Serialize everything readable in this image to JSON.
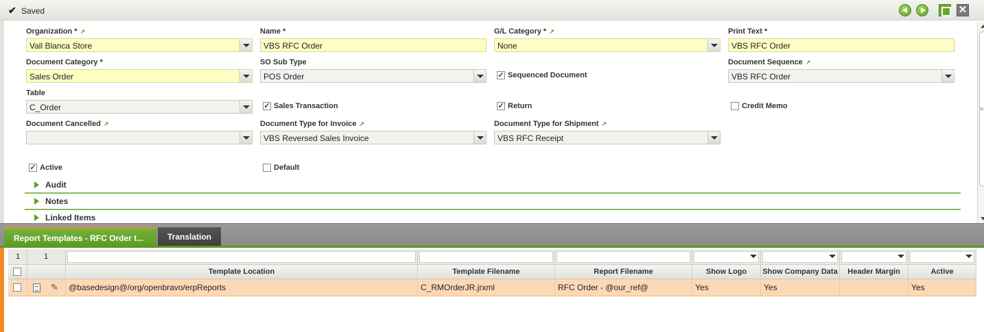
{
  "status": {
    "text": "Saved"
  },
  "form": {
    "fields": {
      "organization": {
        "label": "Organization *",
        "value": "Vall Blanca Store"
      },
      "name": {
        "label": "Name *",
        "value": "VBS RFC Order"
      },
      "gl_category": {
        "label": "G/L Category *",
        "value": "None"
      },
      "print_text": {
        "label": "Print Text *",
        "value": "VBS RFC Order"
      },
      "document_category": {
        "label": "Document Category *",
        "value": "Sales Order"
      },
      "so_sub_type": {
        "label": "SO Sub Type",
        "value": "POS Order"
      },
      "document_sequence": {
        "label": "Document Sequence",
        "value": "VBS RFC Order"
      },
      "table": {
        "label": "Table",
        "value": "C_Order"
      },
      "document_cancelled": {
        "label": "Document Cancelled",
        "value": ""
      },
      "doc_type_invoice": {
        "label": "Document Type for Invoice",
        "value": "VBS Reversed Sales Invoice"
      },
      "doc_type_shipment": {
        "label": "Document Type for Shipment",
        "value": "VBS RFC Receipt"
      }
    },
    "checkboxes": {
      "sequenced_document": {
        "label": "Sequenced Document",
        "checked": true
      },
      "sales_transaction": {
        "label": "Sales Transaction",
        "checked": true
      },
      "return": {
        "label": "Return",
        "checked": true
      },
      "credit_memo": {
        "label": "Credit Memo",
        "checked": false
      },
      "active": {
        "label": "Active",
        "checked": true
      },
      "default": {
        "label": "Default",
        "checked": false
      }
    },
    "sections": {
      "audit": "Audit",
      "notes": "Notes",
      "linked_items": "Linked Items"
    }
  },
  "tabs": {
    "report_templates": "Report Templates - RFC Order t...",
    "translation": "Translation"
  },
  "grid": {
    "filter": {
      "count1": "1",
      "count2": "1"
    },
    "columns": {
      "template_location": "Template Location",
      "template_filename": "Template Filename",
      "report_filename": "Report Filename",
      "show_logo": "Show Logo",
      "show_company_data": "Show Company Data",
      "header_margin": "Header Margin",
      "active": "Active"
    },
    "rows": [
      {
        "template_location": "@basedesign@/org/openbravo/erpReports",
        "template_filename": "C_RMOrderJR.jrxml",
        "report_filename": "RFC Order - @our_ref@",
        "show_logo": "Yes",
        "show_company_data": "Yes",
        "header_margin": "",
        "active": "Yes"
      }
    ]
  },
  "colors": {
    "accent_green": "#5a9a24",
    "accent_orange": "#f08a24",
    "required_yellow": "#fdfdc4",
    "selected_row": "#fcd9b6"
  }
}
